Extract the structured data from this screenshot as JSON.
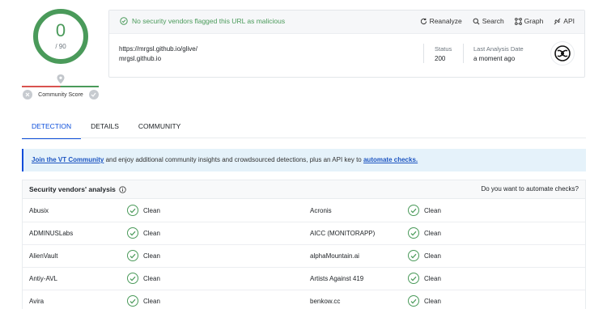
{
  "score": {
    "detections": "0",
    "total": "/ 90"
  },
  "community": {
    "label": "Community Score"
  },
  "header": {
    "status_message": "No security vendors flagged this URL as malicious",
    "actions": {
      "reanalyze": "Reanalyze",
      "search": "Search",
      "graph": "Graph",
      "api": "API"
    },
    "url": "https://mrgsl.github.io/glive/",
    "host": "mrgsl.github.io",
    "status_label": "Status",
    "status_value": "200",
    "last_analysis_label": "Last Analysis Date",
    "last_analysis_value": "a moment ago"
  },
  "tabs": [
    {
      "label": "DETECTION"
    },
    {
      "label": "DETAILS"
    },
    {
      "label": "COMMUNITY"
    }
  ],
  "banner": {
    "link1": "Join the VT Community",
    "text": " and enjoy additional community insights and crowdsourced detections, plus an API key to ",
    "link2": "automate checks."
  },
  "vendors_section": {
    "title": "Security vendors' analysis",
    "automate_prompt": "Do you want to automate checks?",
    "rows": [
      {
        "left_vendor": "Abusix",
        "left_result": "Clean",
        "right_vendor": "Acronis",
        "right_result": "Clean"
      },
      {
        "left_vendor": "ADMINUSLabs",
        "left_result": "Clean",
        "right_vendor": "AICC (MONITORAPP)",
        "right_result": "Clean"
      },
      {
        "left_vendor": "AlienVault",
        "left_result": "Clean",
        "right_vendor": "alphaMountain.ai",
        "right_result": "Clean"
      },
      {
        "left_vendor": "Antiy-AVL",
        "left_result": "Clean",
        "right_vendor": "Artists Against 419",
        "right_result": "Clean"
      },
      {
        "left_vendor": "Avira",
        "left_result": "Clean",
        "right_vendor": "benkow.cc",
        "right_result": "Clean"
      }
    ]
  },
  "colors": {
    "clean": "#4a9a5a",
    "accent": "#0b4dda",
    "banner_bg": "#e5f2fa"
  }
}
